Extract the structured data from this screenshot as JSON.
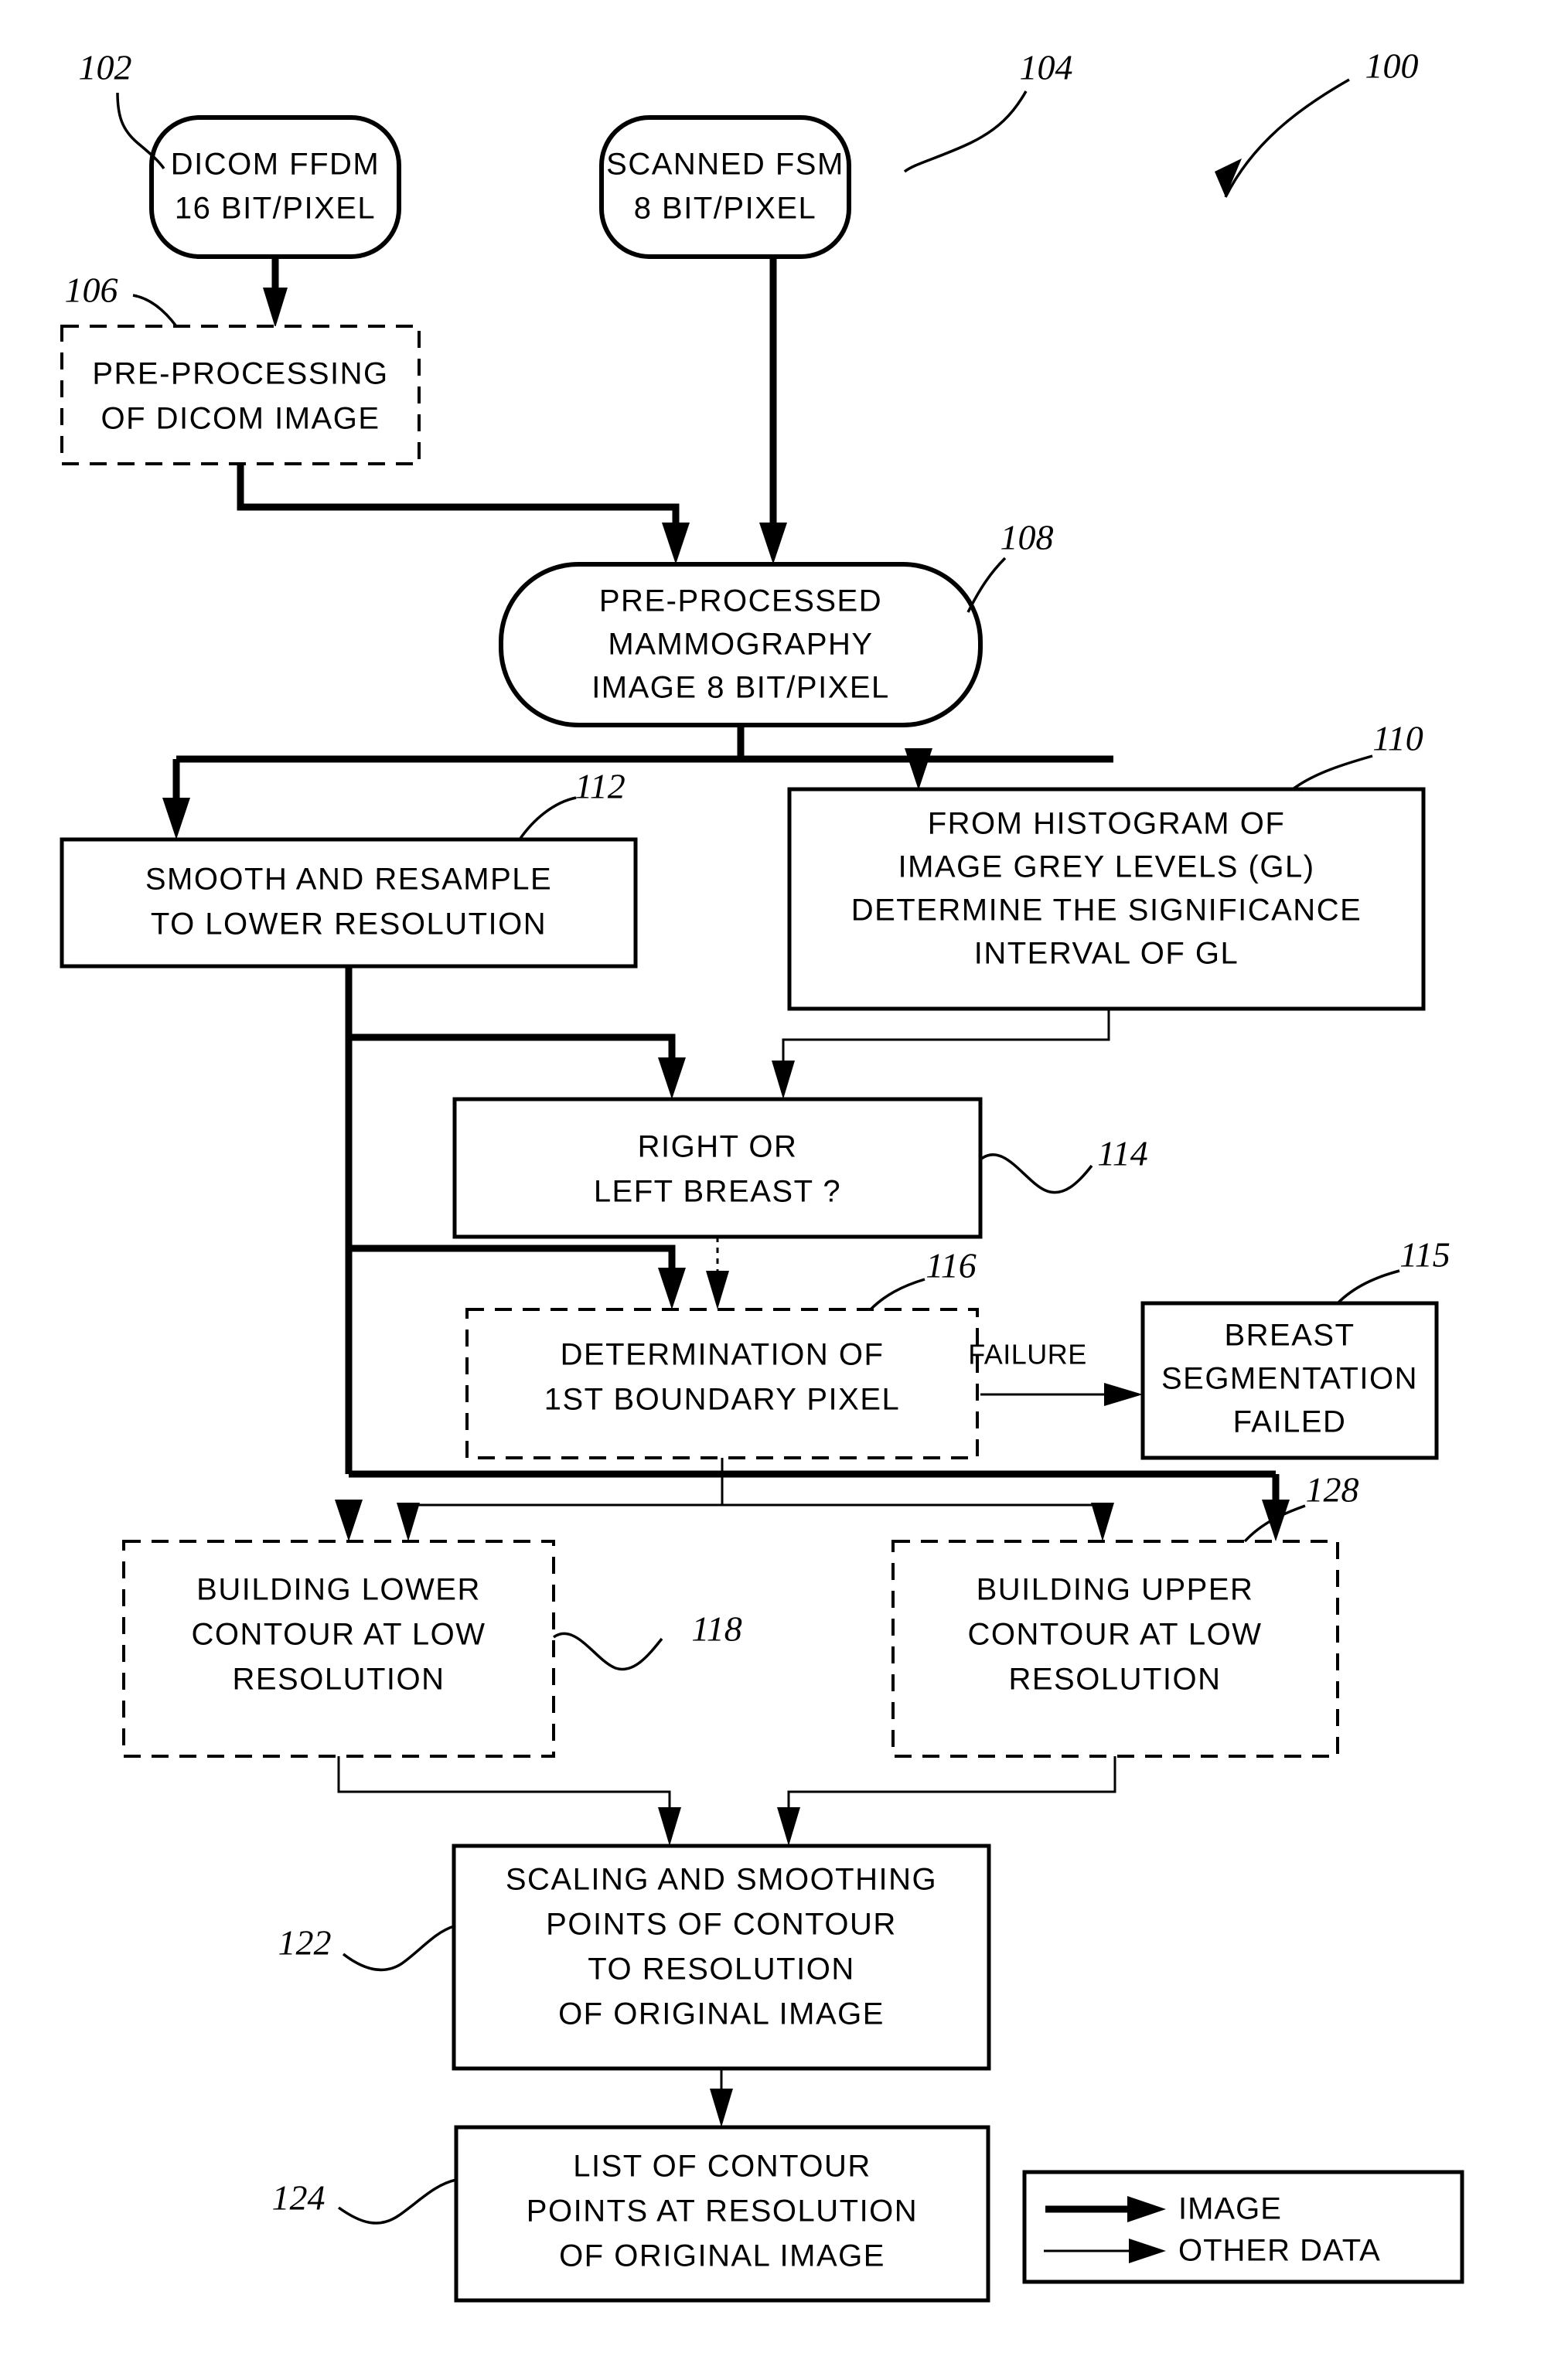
{
  "figure": {
    "ref": "100",
    "type": "flowchart",
    "domain": "patent-diagram",
    "title": "Breast segmentation mammography image processing flowchart"
  },
  "nodes": [
    {
      "ref": "102",
      "shape": "rounded",
      "lines": [
        "DICOM FFDM",
        "16 BIT/PIXEL"
      ],
      "name": "node-dicom-ffdm"
    },
    {
      "ref": "104",
      "shape": "rounded",
      "lines": [
        "SCANNED FSM",
        "8 BIT/PIXEL"
      ],
      "name": "node-scanned-fsm"
    },
    {
      "ref": "106",
      "shape": "dashed",
      "lines": [
        "PRE-PROCESSING",
        "OF DICOM IMAGE"
      ],
      "name": "node-preprocessing-dicom"
    },
    {
      "ref": "108",
      "shape": "rounded",
      "lines": [
        "PRE-PROCESSED",
        "MAMMOGRAPHY",
        "IMAGE 8 BIT/PIXEL"
      ],
      "name": "node-preprocessed-mammography"
    },
    {
      "ref": "112",
      "shape": "solid",
      "lines": [
        "SMOOTH AND RESAMPLE",
        "TO LOWER RESOLUTION"
      ],
      "name": "node-smooth-resample"
    },
    {
      "ref": "110",
      "shape": "solid",
      "lines": [
        "FROM HISTOGRAM OF",
        "IMAGE GREY LEVELS (GL)",
        "DETERMINE THE SIGNIFICANCE",
        "INTERVAL OF GL"
      ],
      "name": "node-histogram-significance"
    },
    {
      "ref": "114",
      "shape": "solid",
      "lines": [
        "RIGHT OR",
        "LEFT BREAST ?"
      ],
      "name": "node-right-or-left-breast"
    },
    {
      "ref": "116",
      "shape": "dashed",
      "lines": [
        "DETERMINATION OF",
        "1ST BOUNDARY PIXEL"
      ],
      "name": "node-determination-boundary-pixel"
    },
    {
      "ref": "115",
      "shape": "solid",
      "lines": [
        "BREAST",
        "SEGMENTATION",
        "FAILED"
      ],
      "name": "node-breast-segmentation-failed"
    },
    {
      "ref": "118",
      "shape": "dashed",
      "lines": [
        "BUILDING LOWER",
        "CONTOUR AT LOW",
        "RESOLUTION"
      ],
      "name": "node-building-lower-contour"
    },
    {
      "ref": "128",
      "shape": "dashed",
      "lines": [
        "BUILDING UPPER",
        "CONTOUR AT LOW",
        "RESOLUTION"
      ],
      "name": "node-building-upper-contour"
    },
    {
      "ref": "122",
      "shape": "solid",
      "lines": [
        "SCALING AND SMOOTHING",
        "POINTS OF CONTOUR",
        "TO RESOLUTION",
        "OF ORIGINAL IMAGE"
      ],
      "name": "node-scaling-smoothing"
    },
    {
      "ref": "124",
      "shape": "solid",
      "lines": [
        "LIST OF CONTOUR",
        "POINTS AT RESOLUTION",
        "OF ORIGINAL IMAGE"
      ],
      "name": "node-list-contour-points"
    }
  ],
  "edge_labels": {
    "failure": "FAILURE"
  },
  "legend": {
    "items": [
      {
        "label": "IMAGE",
        "style": "thick-arrow"
      },
      {
        "label": "OTHER DATA",
        "style": "thin-arrow"
      }
    ]
  },
  "colors": {
    "ink": "#000000",
    "paper": "#ffffff"
  }
}
